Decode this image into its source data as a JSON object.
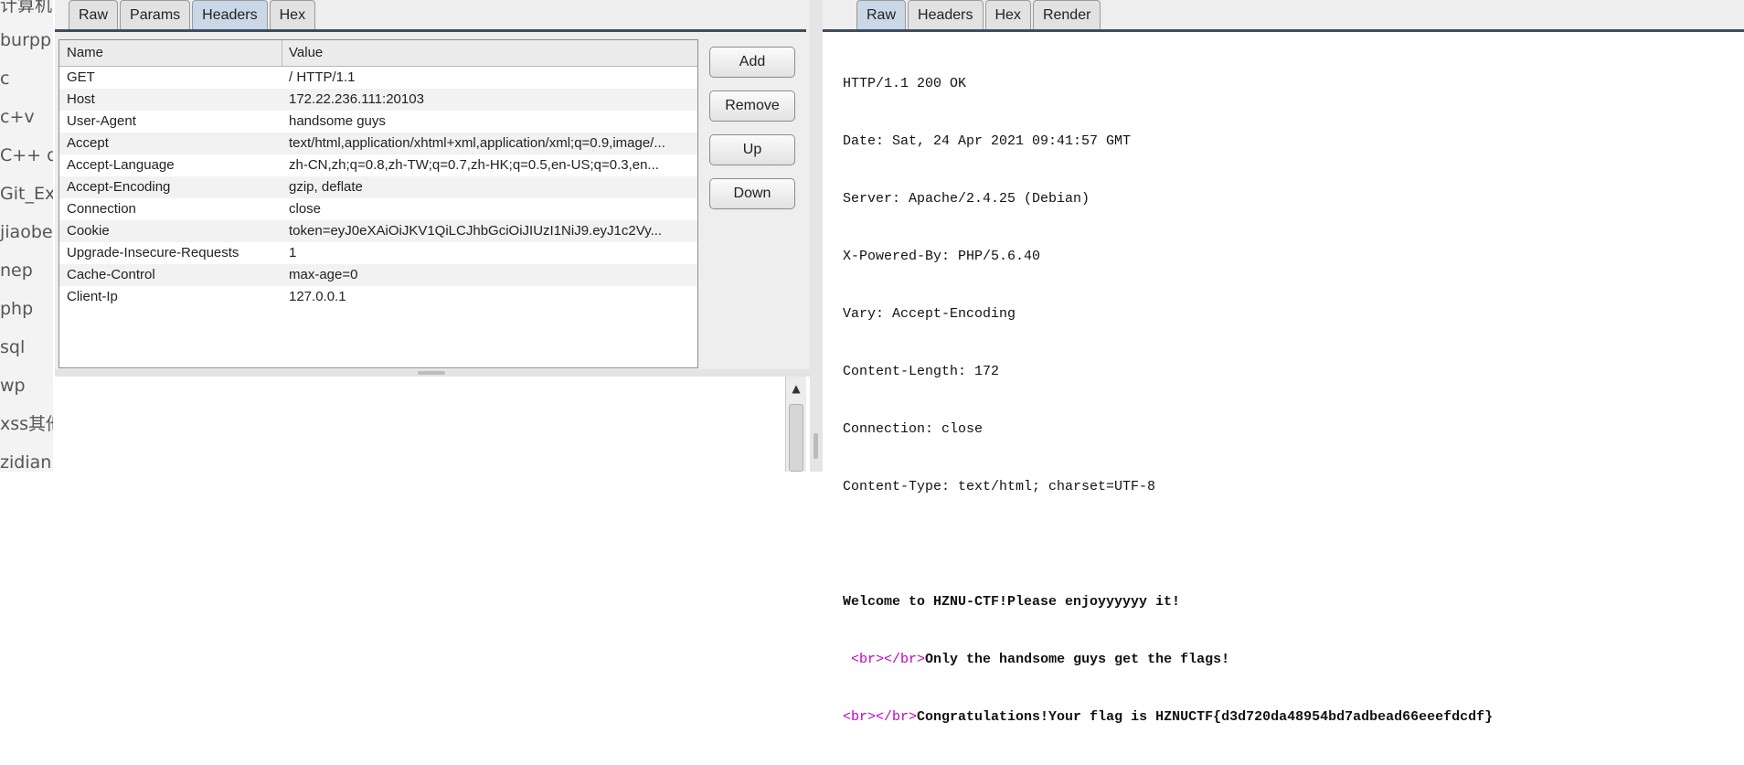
{
  "sidebar": {
    "items": [
      "计算机",
      "burpp",
      "c",
      "c+v",
      "C++ d",
      "Git_Ex",
      "jiaobe",
      "nep",
      "php",
      "sql",
      "wp",
      "xss其他",
      "zidian"
    ]
  },
  "request": {
    "tabs": [
      "Raw",
      "Params",
      "Headers",
      "Hex"
    ],
    "active_tab": "Headers",
    "table": {
      "col_name": "Name",
      "col_value": "Value",
      "rows": [
        {
          "name": "GET",
          "value": "/ HTTP/1.1"
        },
        {
          "name": "Host",
          "value": "172.22.236.111:20103"
        },
        {
          "name": "User-Agent",
          "value": "handsome guys"
        },
        {
          "name": "Accept",
          "value": "text/html,application/xhtml+xml,application/xml;q=0.9,image/..."
        },
        {
          "name": "Accept-Language",
          "value": "zh-CN,zh;q=0.8,zh-TW;q=0.7,zh-HK;q=0.5,en-US;q=0.3,en..."
        },
        {
          "name": "Accept-Encoding",
          "value": "gzip, deflate"
        },
        {
          "name": "Connection",
          "value": "close"
        },
        {
          "name": "Cookie",
          "value": "token=eyJ0eXAiOiJKV1QiLCJhbGciOiJIUzI1NiJ9.eyJ1c2Vy..."
        },
        {
          "name": "Upgrade-Insecure-Requests",
          "value": "1"
        },
        {
          "name": "Cache-Control",
          "value": "max-age=0"
        },
        {
          "name": "Client-Ip",
          "value": "127.0.0.1"
        }
      ]
    },
    "buttons": {
      "add": "Add",
      "remove": "Remove",
      "up": "Up",
      "down": "Down"
    }
  },
  "response": {
    "tabs": [
      "Raw",
      "Headers",
      "Hex",
      "Render"
    ],
    "active_tab": "Raw",
    "headers": [
      "HTTP/1.1 200 OK",
      "Date: Sat, 24 Apr 2021 09:41:57 GMT",
      "Server: Apache/2.4.25 (Debian)",
      "X-Powered-By: PHP/5.6.40",
      "Vary: Accept-Encoding",
      "Content-Length: 172",
      "Connection: close",
      "Content-Type: text/html; charset=UTF-8"
    ],
    "body": {
      "welcome": "Welcome to HZNU-CTF!Please enjoyyyyyy it!",
      "line2_indent": " ",
      "br_open": "<br>",
      "br_close": "</br>",
      "only_handsome": "Only the handsome guys get the flags!",
      "congrats": "Congratulations!Your flag is HZNUCTF{d3d720da48954bd7adbead66eeefdcdf}"
    }
  },
  "colors": {
    "active_tab": "#c9d7e6",
    "tab_rule": "#3e4c60",
    "tag": "#c000c0"
  }
}
